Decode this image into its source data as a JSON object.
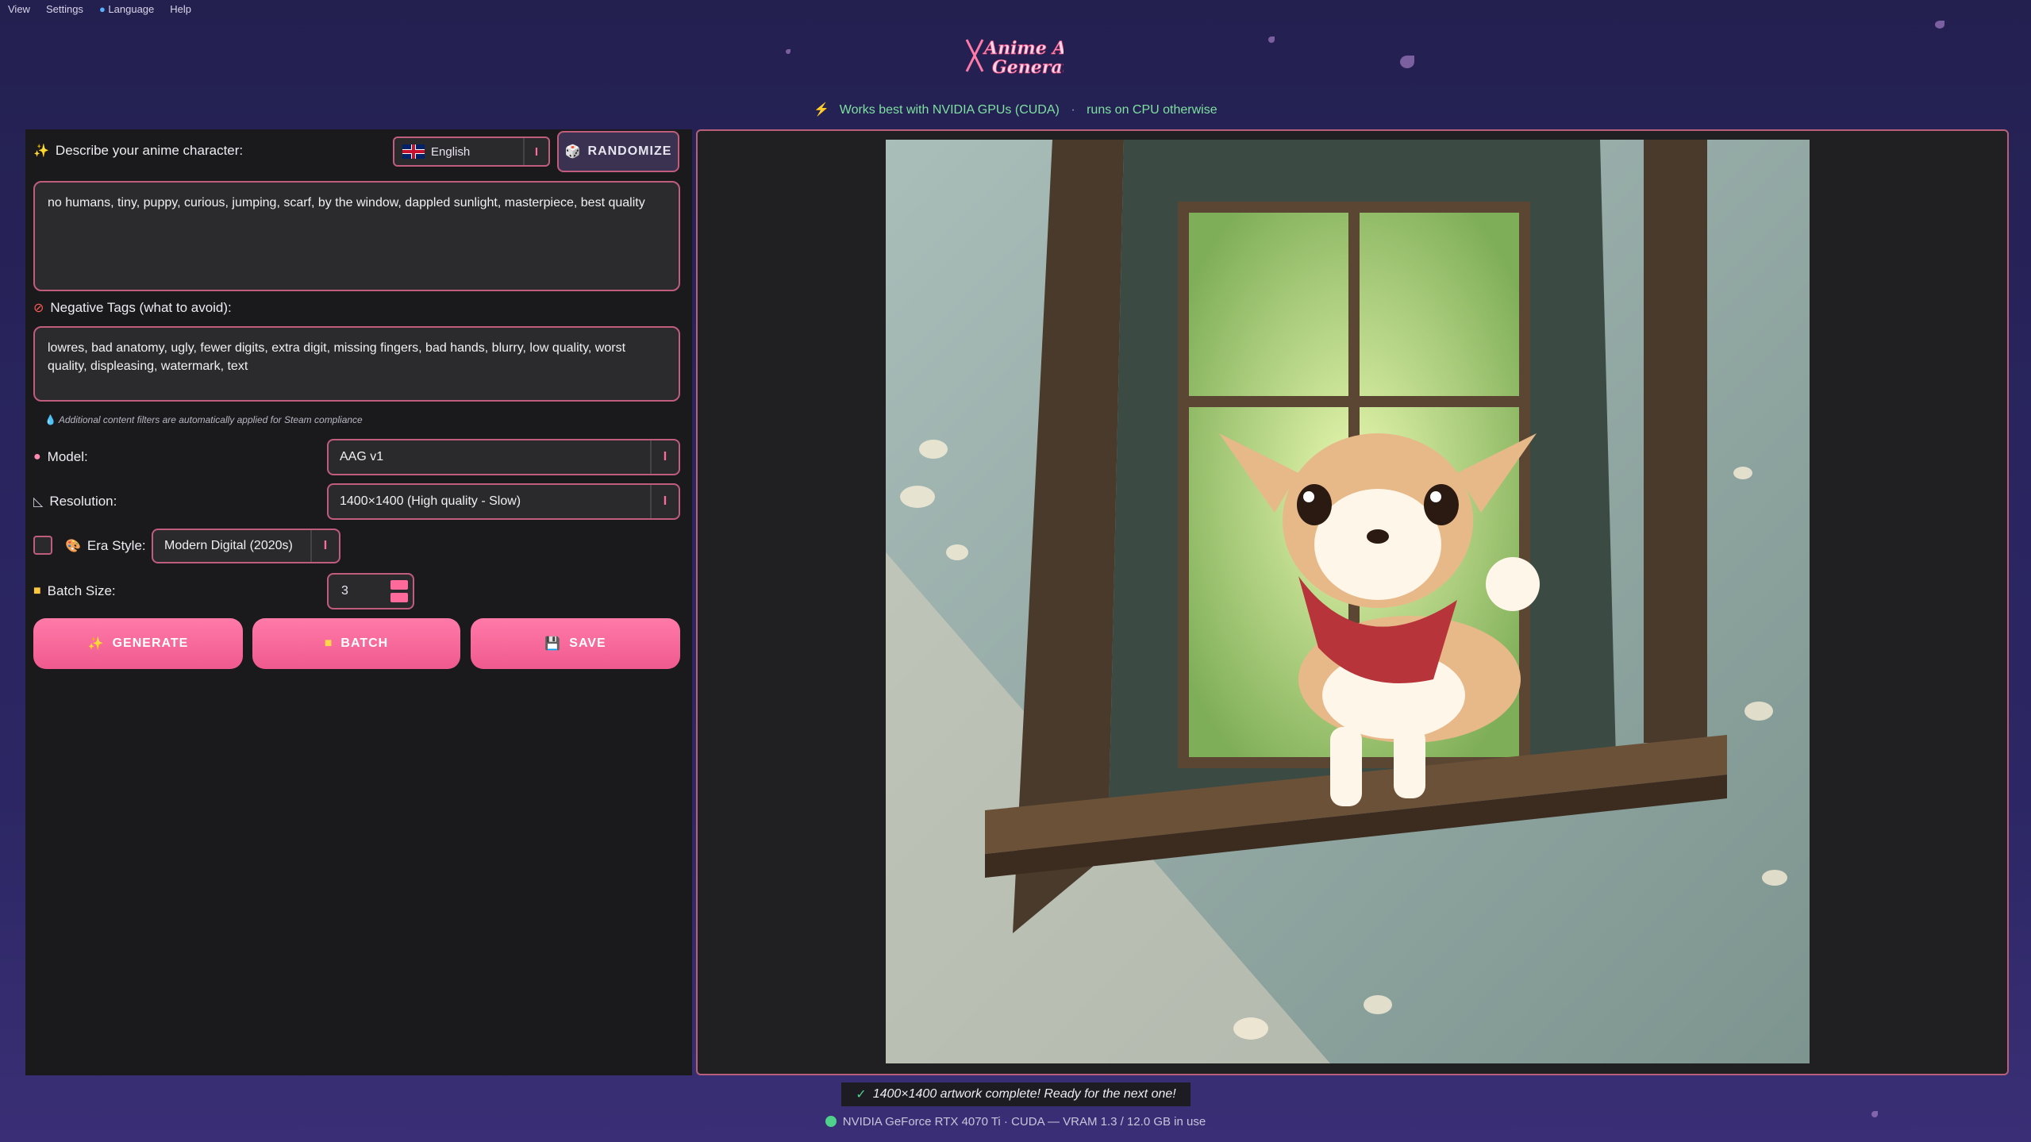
{
  "menu": [
    "View",
    "Settings",
    "Language",
    "Help"
  ],
  "logo_text": [
    "Anime Art",
    "Generator"
  ],
  "notice": {
    "left": "Works best with NVIDIA GPUs (CUDA)",
    "sep": "·",
    "right": "runs on CPU otherwise"
  },
  "prompt": {
    "label": "Describe your anime character:",
    "value": "no humans, tiny, puppy, curious, jumping, scarf, by the window, dappled sunlight, masterpiece, best quality"
  },
  "language": {
    "selected": "English",
    "arrow": "I"
  },
  "randomize_label": "RANDOMIZE",
  "negative": {
    "label": "Negative Tags (what to avoid):",
    "value": "lowres, bad anatomy, ugly, fewer digits, extra digit, missing fingers, bad hands, blurry, low quality, worst quality, displeasing, watermark, text"
  },
  "compliance_note": "Additional content filters are automatically applied for Steam compliance",
  "model": {
    "label": "Model:",
    "selected": "AAG v1"
  },
  "resolution": {
    "label": "Resolution:",
    "selected": "1400×1400 (High quality - Slow)"
  },
  "era": {
    "label": "Era Style:",
    "selected": "Modern Digital (2020s)"
  },
  "batch": {
    "label": "Batch Size:",
    "value": "3"
  },
  "buttons": {
    "generate": "GENERATE",
    "batch": "BATCH",
    "save": "SAVE"
  },
  "status_message": "1400×1400 artwork complete! Ready for the next one!",
  "gpu_status": "NVIDIA GeForce RTX 4070 Ti · CUDA — VRAM 1.3 / 12.0 GB in use",
  "colors": {
    "accent": "#f05a8e",
    "border": "#c05c7c",
    "ok": "#4fd18b",
    "notice": "#7fe0a0"
  }
}
